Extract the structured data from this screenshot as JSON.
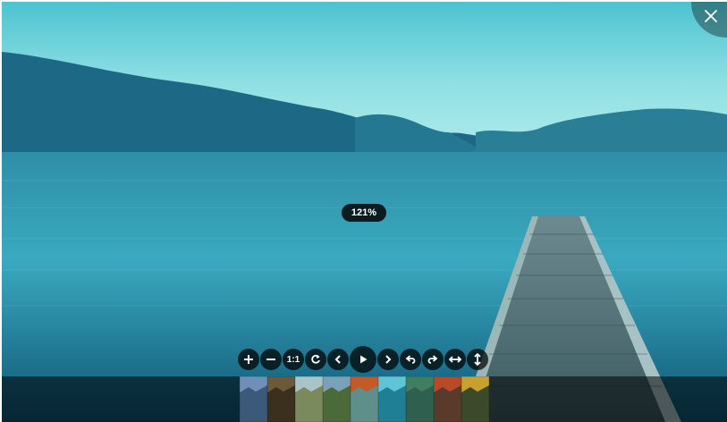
{
  "viewer": {
    "zoom_label": "121%",
    "toolbar": [
      {
        "name": "zoom-in-button",
        "icon": "plus-icon",
        "label": ""
      },
      {
        "name": "zoom-out-button",
        "icon": "minus-icon",
        "label": ""
      },
      {
        "name": "one-to-one-button",
        "icon": "",
        "label": "1:1"
      },
      {
        "name": "reset-button",
        "icon": "refresh-icon",
        "label": ""
      },
      {
        "name": "prev-button",
        "icon": "chevron-left-icon",
        "label": ""
      },
      {
        "name": "play-button",
        "icon": "play-icon",
        "label": ""
      },
      {
        "name": "next-button",
        "icon": "chevron-right-icon",
        "label": ""
      },
      {
        "name": "rotate-left-button",
        "icon": "rotate-left-icon",
        "label": ""
      },
      {
        "name": "rotate-right-button",
        "icon": "rotate-right-icon",
        "label": ""
      },
      {
        "name": "flip-horizontal-button",
        "icon": "flip-horizontal-icon",
        "label": ""
      },
      {
        "name": "flip-vertical-button",
        "icon": "flip-vertical-icon",
        "label": ""
      }
    ],
    "thumbnails": [
      {
        "name": "thumbnail-mountains",
        "sky": "#6f8fb8",
        "ground": "#3b5a7a",
        "active": false
      },
      {
        "name": "thumbnail-brown-landscape",
        "sky": "#6b5a3a",
        "ground": "#3b2f1d",
        "active": false
      },
      {
        "name": "thumbnail-hills",
        "sky": "#a9c4c7",
        "ground": "#7a8a5c",
        "active": false
      },
      {
        "name": "thumbnail-valley",
        "sky": "#7aa1b8",
        "ground": "#4a6a3a",
        "active": false
      },
      {
        "name": "thumbnail-waterfall-autumn",
        "sky": "#c25a2a",
        "ground": "#5f8f8a",
        "active": false
      },
      {
        "name": "thumbnail-lake-pier",
        "sky": "#5fc4d8",
        "ground": "#1f7f94",
        "active": true
      },
      {
        "name": "thumbnail-forest-stream",
        "sky": "#3f7f5f",
        "ground": "#2f5f4f",
        "active": false
      },
      {
        "name": "thumbnail-autumn-trees",
        "sky": "#b84a2a",
        "ground": "#5a3a2a",
        "active": false
      },
      {
        "name": "thumbnail-temple",
        "sky": "#c8a030",
        "ground": "#3a4a2a",
        "active": false
      }
    ]
  }
}
